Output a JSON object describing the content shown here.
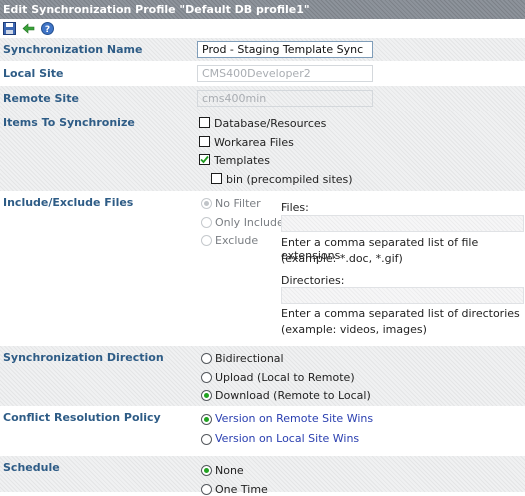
{
  "header": {
    "title": "Edit Synchronization Profile \"Default DB profile1\""
  },
  "toolbar": {
    "icons": [
      "save-icon",
      "back-icon",
      "help-icon"
    ]
  },
  "sync_name": {
    "label": "Synchronization Name",
    "value": "Prod - Staging Template Sync"
  },
  "local_site": {
    "label": "Local Site",
    "value": "CMS400Developer2"
  },
  "remote_site": {
    "label": "Remote Site",
    "value": "cms400min"
  },
  "items": {
    "label": "Items To Synchronize",
    "database": {
      "label": "Database/Resources",
      "checked": false
    },
    "workarea": {
      "label": "Workarea Files",
      "checked": false
    },
    "templates": {
      "label": "Templates",
      "checked": true
    },
    "bin": {
      "label": "bin (precompiled sites)",
      "checked": false
    }
  },
  "include_exclude": {
    "label": "Include/Exclude Files",
    "options": [
      "No Filter",
      "Only Include",
      "Exclude"
    ],
    "selected": "No Filter",
    "files_label": "Files:",
    "files_help_1": "Enter a comma separated list of file extensions",
    "files_help_2": "(example: *.doc, *.gif)",
    "dirs_label": "Directories:",
    "dirs_help_1": "Enter a comma separated list of directories",
    "dirs_help_2": "(example: videos, images)"
  },
  "direction": {
    "label": "Synchronization Direction",
    "options": [
      "Bidirectional",
      "Upload (Local to Remote)",
      "Download (Remote to Local)"
    ],
    "selected": "Download (Remote to Local)"
  },
  "conflict": {
    "label": "Conflict Resolution Policy",
    "options": [
      "Version on Remote Site Wins",
      "Version on Local Site Wins"
    ],
    "selected": "Version on Remote Site Wins"
  },
  "schedule": {
    "label": "Schedule",
    "options": [
      "None",
      "One Time"
    ],
    "selected": "None"
  },
  "colors": {
    "label_blue": "#2e5c86",
    "radio_green": "#21a321",
    "link_blue": "#2a3fb0"
  }
}
